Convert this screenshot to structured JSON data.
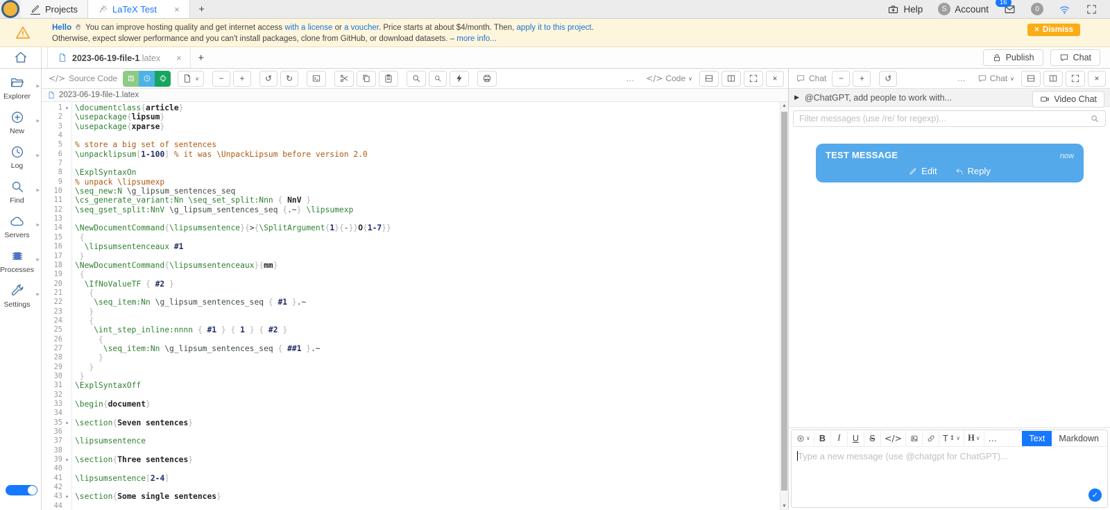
{
  "topbar": {
    "tabs": [
      {
        "label": "Projects"
      },
      {
        "label": "LaTeX Test"
      }
    ],
    "right": {
      "help": "Help",
      "avatar": "S",
      "account": "Account",
      "mail_badge": "16",
      "connections": "0"
    }
  },
  "banner": {
    "line1": [
      {
        "t": "Hello",
        "s": "linkb"
      },
      {
        "icon": "wave"
      },
      {
        "t": "You can improve hosting quality and get internet access ",
        "s": "p"
      },
      {
        "t": "with a license",
        "s": "link"
      },
      {
        "t": " or ",
        "s": "p"
      },
      {
        "t": "a voucher",
        "s": "link"
      },
      {
        "t": ". Price starts at about $4/month. Then, ",
        "s": "p"
      },
      {
        "t": "apply it to this project",
        "s": "link"
      },
      {
        "t": ".",
        "s": "p"
      }
    ],
    "line2": [
      {
        "t": "Otherwise, expect slower performance and you can't install packages, clone from GitHub, or download datasets. – ",
        "s": "p"
      },
      {
        "t": "more info...",
        "s": "link"
      }
    ],
    "dismiss": "Dismiss"
  },
  "sidebar": {
    "items": [
      {
        "label": "Explorer",
        "icon": "folder"
      },
      {
        "label": "New",
        "icon": "plus-circle"
      },
      {
        "label": "Log",
        "icon": "clock"
      },
      {
        "label": "Find",
        "icon": "search"
      },
      {
        "label": "Servers",
        "icon": "cloud"
      },
      {
        "label": "Processes",
        "icon": "chip"
      },
      {
        "label": "Settings",
        "icon": "wrench"
      }
    ]
  },
  "filebar": {
    "tab_name": "2023-06-19-file-1",
    "tab_ext": ".latex",
    "publish": "Publish",
    "chat": "Chat"
  },
  "editor": {
    "mode_label": "Source Code",
    "code_dropdown": "Code",
    "path": "2023-06-19-file-1.latex",
    "folds": [
      1,
      35,
      39,
      43
    ],
    "lines": [
      [
        [
          "c",
          "\\documentclass"
        ],
        [
          "b",
          "{"
        ],
        [
          "a",
          "article"
        ],
        [
          "b",
          "}"
        ]
      ],
      [
        [
          "c",
          "\\usepackage"
        ],
        [
          "b",
          "{"
        ],
        [
          "a",
          "lipsum"
        ],
        [
          "b",
          "}"
        ]
      ],
      [
        [
          "c",
          "\\usepackage"
        ],
        [
          "b",
          "{"
        ],
        [
          "a",
          "xparse"
        ],
        [
          "b",
          "}"
        ]
      ],
      [],
      [
        [
          "m",
          "% store a big set of sentences"
        ]
      ],
      [
        [
          "c",
          "\\unpacklipsum"
        ],
        [
          "b",
          "["
        ],
        [
          "n",
          "1-100"
        ],
        [
          "b",
          "]"
        ],
        [
          "m",
          " % it was \\UnpackLipsum before version 2.0"
        ]
      ],
      [],
      [
        [
          "c",
          "\\ExplSyntaxOn"
        ]
      ],
      [
        [
          "m",
          "% unpack \\lipsumexp"
        ]
      ],
      [
        [
          "c",
          "\\seq_new:N"
        ],
        [
          "p",
          " "
        ],
        [
          "v",
          "\\g_lipsum_sentences_seq"
        ]
      ],
      [
        [
          "c",
          "\\cs_generate_variant:Nn"
        ],
        [
          "p",
          " "
        ],
        [
          "c",
          "\\seq_set_split:Nnn"
        ],
        [
          "b",
          " { "
        ],
        [
          "a",
          "NnV"
        ],
        [
          "b",
          " }"
        ]
      ],
      [
        [
          "c",
          "\\seq_gset_split:NnV"
        ],
        [
          "p",
          " "
        ],
        [
          "v",
          "\\g_lipsum_sentences_seq"
        ],
        [
          "b",
          " {"
        ],
        [
          "p",
          ".~"
        ],
        [
          "b",
          "}"
        ],
        [
          "p",
          " "
        ],
        [
          "c",
          "\\lipsumexp"
        ]
      ],
      [],
      [
        [
          "c",
          "\\NewDocumentCommand"
        ],
        [
          "b",
          "{"
        ],
        [
          "c",
          "\\lipsumsentence"
        ],
        [
          "b",
          "}{"
        ],
        [
          "p",
          ">"
        ],
        [
          "b",
          "{"
        ],
        [
          "c",
          "\\SplitArgument"
        ],
        [
          "b",
          "{"
        ],
        [
          "n",
          "1"
        ],
        [
          "b",
          "}{"
        ],
        [
          "p",
          "-"
        ],
        [
          "b",
          "}}"
        ],
        [
          "a",
          "O"
        ],
        [
          "b",
          "{"
        ],
        [
          "n",
          "1-7"
        ],
        [
          "b",
          "}}"
        ]
      ],
      [
        [
          "b",
          " {"
        ]
      ],
      [
        [
          "c",
          "  \\lipsumsentenceaux"
        ],
        [
          "n",
          " #1"
        ]
      ],
      [
        [
          "b",
          " }"
        ]
      ],
      [
        [
          "c",
          "\\NewDocumentCommand"
        ],
        [
          "b",
          "{"
        ],
        [
          "c",
          "\\lipsumsentenceaux"
        ],
        [
          "b",
          "}{"
        ],
        [
          "a",
          "mm"
        ],
        [
          "b",
          "}"
        ]
      ],
      [
        [
          "b",
          " {"
        ]
      ],
      [
        [
          "c",
          "  \\IfNoValueTF"
        ],
        [
          "b",
          " { "
        ],
        [
          "n",
          "#2"
        ],
        [
          "b",
          " }"
        ]
      ],
      [
        [
          "b",
          "   {"
        ]
      ],
      [
        [
          "c",
          "    \\seq_item:Nn"
        ],
        [
          "p",
          " "
        ],
        [
          "v",
          "\\g_lipsum_sentences_seq"
        ],
        [
          "b",
          " { "
        ],
        [
          "n",
          "#1"
        ],
        [
          "b",
          " }"
        ],
        [
          "p",
          ".~"
        ]
      ],
      [
        [
          "b",
          "   }"
        ]
      ],
      [
        [
          "b",
          "   {"
        ]
      ],
      [
        [
          "c",
          "    \\int_step_inline:nnnn"
        ],
        [
          "b",
          " { "
        ],
        [
          "n",
          "#1"
        ],
        [
          "b",
          " } { "
        ],
        [
          "n",
          "1"
        ],
        [
          "b",
          " } { "
        ],
        [
          "n",
          "#2"
        ],
        [
          "b",
          " }"
        ]
      ],
      [
        [
          "b",
          "     {"
        ]
      ],
      [
        [
          "c",
          "      \\seq_item:Nn"
        ],
        [
          "p",
          " "
        ],
        [
          "v",
          "\\g_lipsum_sentences_seq"
        ],
        [
          "b",
          " { "
        ],
        [
          "n",
          "##1"
        ],
        [
          "b",
          " }"
        ],
        [
          "p",
          ".~"
        ]
      ],
      [
        [
          "b",
          "     }"
        ]
      ],
      [
        [
          "b",
          "   }"
        ]
      ],
      [
        [
          "b",
          " }"
        ]
      ],
      [
        [
          "c",
          "\\ExplSyntaxOff"
        ]
      ],
      [],
      [
        [
          "c",
          "\\begin"
        ],
        [
          "b",
          "{"
        ],
        [
          "a",
          "document"
        ],
        [
          "b",
          "}"
        ]
      ],
      [],
      [
        [
          "c",
          "\\section"
        ],
        [
          "b",
          "{"
        ],
        [
          "a",
          "Seven sentences"
        ],
        [
          "b",
          "}"
        ]
      ],
      [],
      [
        [
          "c",
          "\\lipsumsentence"
        ]
      ],
      [],
      [
        [
          "c",
          "\\section"
        ],
        [
          "b",
          "{"
        ],
        [
          "a",
          "Three sentences"
        ],
        [
          "b",
          "}"
        ]
      ],
      [],
      [
        [
          "c",
          "\\lipsumsentence"
        ],
        [
          "b",
          "["
        ],
        [
          "n",
          "2-4"
        ],
        [
          "b",
          "]"
        ]
      ],
      [],
      [
        [
          "c",
          "\\section"
        ],
        [
          "b",
          "{"
        ],
        [
          "a",
          "Some single sentences"
        ],
        [
          "b",
          "}"
        ]
      ],
      []
    ]
  },
  "chat": {
    "toolbar_label": "Chat",
    "chat_dropdown": "Chat",
    "collab_placeholder": "@ChatGPT, add people to work with...",
    "video_chat": "Video Chat",
    "filter_placeholder": "Filter messages (use /re/ for regexp)...",
    "message": {
      "text": "TEST MESSAGE",
      "time": "now",
      "edit": "Edit",
      "reply": "Reply"
    },
    "composer": {
      "placeholder": "Type a new message (use @chatgpt for ChatGPT)...",
      "bold": "B",
      "italic": "I",
      "underline": "U",
      "strike": "S",
      "fontsize": "T",
      "heading": "H",
      "tab_text": "Text",
      "tab_markdown": "Markdown"
    }
  },
  "icons": {
    "minus": "−",
    "plus": "+",
    "undo": "↺",
    "redo": "↻",
    "ellipsis": "…",
    "chevron": "∨",
    "close": "×",
    "caret": "▸",
    "fold": "▾",
    "code": "</>",
    "check": "✓",
    "play": "▶",
    "up": "▲",
    "down": "▼",
    "updown": "↕"
  },
  "colors": {
    "accent_blue": "#1677ff",
    "bubble_blue": "#54a9eb",
    "save_green": "#8fca84",
    "timetravel_blue": "#4db3e6",
    "chatgpt_green": "#18a55f",
    "dismiss_orange": "#fbad17",
    "banner_bg": "#fdf6dd",
    "command_green": "#2f8132",
    "comment_orange": "#b05a10"
  }
}
